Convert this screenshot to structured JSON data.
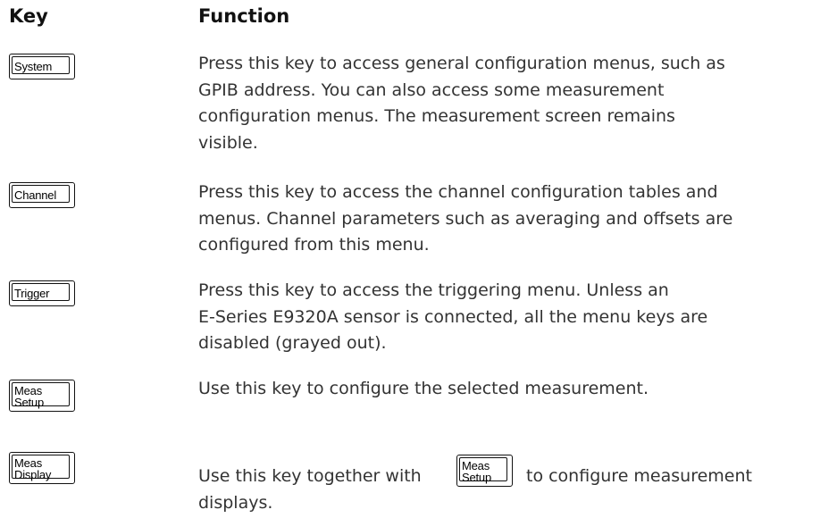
{
  "headers": {
    "key": "Key",
    "function": "Function"
  },
  "rows": [
    {
      "key_label": "System",
      "description_lines": [
        "Press this key to access general configuration menus, such as",
        "GPIB address. You can also access some measurement",
        "configuration menus. The measurement screen remains",
        "visible."
      ]
    },
    {
      "key_label": "Channel",
      "description_lines": [
        "Press this key to access the channel configuration tables and",
        "menus. Channel parameters such as averaging and offsets are",
        "configured from this menu."
      ]
    },
    {
      "key_label": "Trigger",
      "description_lines": [
        "Press this key to access the triggering menu. Unless an",
        "E-Series E9320A sensor is connected, all the menu keys are",
        "disabled (grayed out)."
      ]
    },
    {
      "key_label_lines": [
        "Meas",
        "Setup"
      ],
      "description_lines": [
        "Use this key to configure the selected measurement."
      ]
    },
    {
      "key_label_lines": [
        "Meas",
        "Display"
      ],
      "description_before_key": "Use this key together with",
      "inline_key_label_lines": [
        "Meas",
        "Setup"
      ],
      "description_after_key": "to configure measurement",
      "description_continuation": "displays."
    }
  ]
}
